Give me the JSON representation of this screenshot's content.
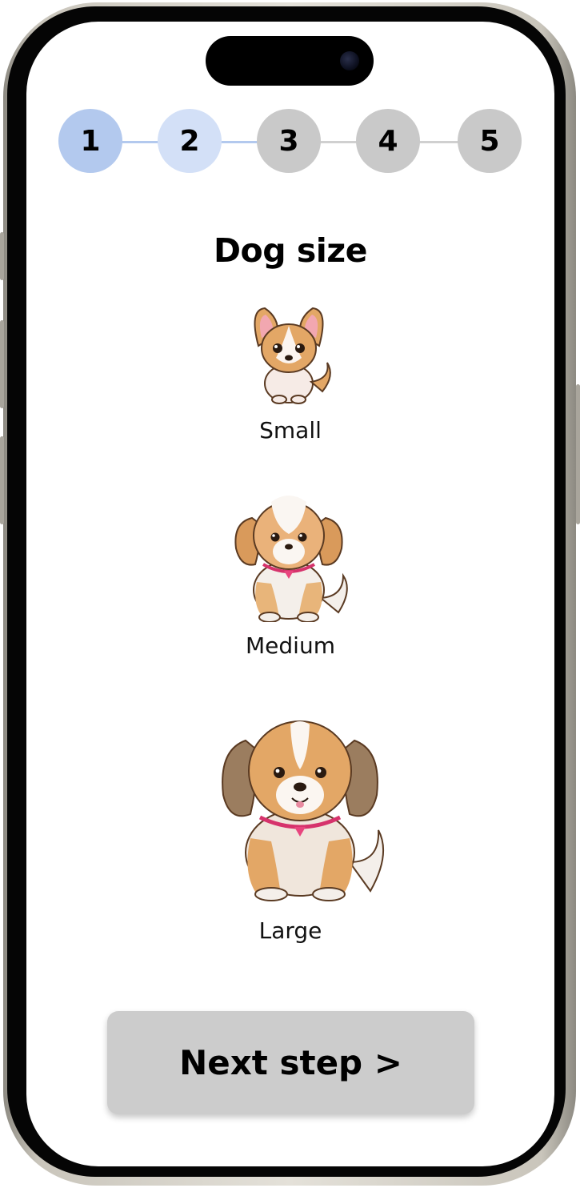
{
  "stepper": {
    "steps": [
      {
        "label": "1",
        "color": "#b3c9ee"
      },
      {
        "label": "2",
        "color": "#d3e0f7"
      },
      {
        "label": "3",
        "color": "#c9c9c9"
      },
      {
        "label": "4",
        "color": "#c9c9c9"
      },
      {
        "label": "5",
        "color": "#c9c9c9"
      }
    ],
    "active_connector_color": "#b3c9ee",
    "inactive_connector_color": "#d0d0d0"
  },
  "title": "Dog size",
  "options": [
    {
      "label": "Small",
      "icon": "small-dog-icon"
    },
    {
      "label": "Medium",
      "icon": "medium-dog-icon"
    },
    {
      "label": "Large",
      "icon": "large-dog-icon"
    }
  ],
  "next_button": {
    "label": "Next step >"
  }
}
